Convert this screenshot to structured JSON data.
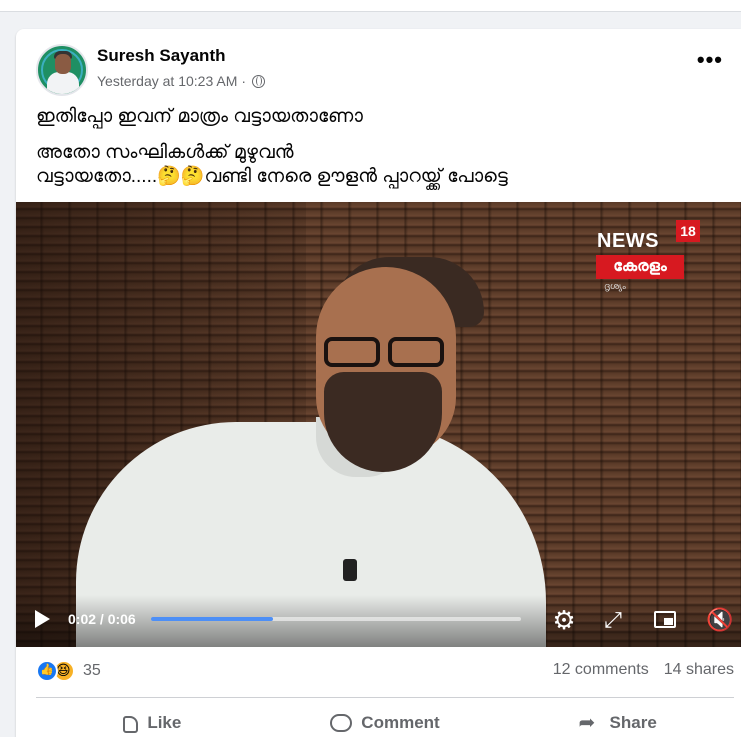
{
  "post": {
    "author": "Suresh Sayanth",
    "timestamp": "Yesterday at 10:23 AM",
    "separator": "·",
    "privacy_icon": "globe-icon",
    "more_label": "•••",
    "text_line1": "ഇതിപ്പോ ഇവന് മാത്രം വട്ടായതാണോ",
    "text_line2": "അതോ സംഘികൾക്ക് മുഴുവൻ",
    "text_line3": "വട്ടായതോ.....🤔🤔വണ്ടി നേരെ ഊളൻ പ്പാറയ്ക്ക് പോട്ടെ"
  },
  "video": {
    "channel_name": "NEWS",
    "channel_number": "18",
    "channel_region": "കേരളം",
    "channel_sub": "ദൃശ്യം",
    "time_display": "0:02 / 0:06",
    "progress": 0.33
  },
  "engagement": {
    "reaction_count": "35",
    "comments": "12 comments",
    "shares": "14 shares"
  },
  "actions": {
    "like": "Like",
    "comment": "Comment",
    "share": "Share"
  },
  "colors": {
    "accent": "#1877f2",
    "progress": "#4d8ff6",
    "brand_red": "#d71920"
  }
}
